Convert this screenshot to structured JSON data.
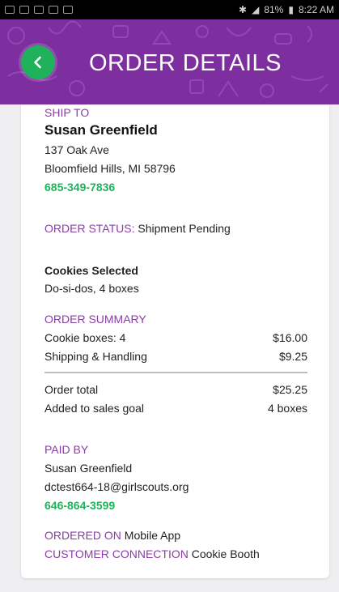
{
  "status_bar": {
    "battery": "81%",
    "time": "8:22 AM"
  },
  "header": {
    "title": "ORDER DETAILS",
    "back_icon": "chevron-left-icon",
    "accent_color": "#7e2f9f",
    "button_color": "#1fb25a"
  },
  "ship_to": {
    "label": "SHIP TO",
    "name": "Susan Greenfield",
    "address_line1": "137 Oak Ave",
    "address_line2": "Bloomfield Hills, MI 58796",
    "phone": "685-349-7836"
  },
  "order_status": {
    "label": "ORDER STATUS:",
    "value": "Shipment Pending"
  },
  "cookies": {
    "heading": "Cookies Selected",
    "value": "Do-si-dos, 4 boxes"
  },
  "summary": {
    "label": "ORDER SUMMARY",
    "lines": [
      {
        "label": "Cookie boxes: 4",
        "value": "$16.00"
      },
      {
        "label": "Shipping & Handling",
        "value": "$9.25"
      }
    ],
    "total_label": "Order total",
    "total_value": "$25.25",
    "goal_label": "Added to sales goal",
    "goal_value": "4 boxes"
  },
  "paid_by": {
    "label": "PAID BY",
    "name": "Susan Greenfield",
    "email": "dctest664-18@girlscouts.org",
    "phone": "646-864-3599"
  },
  "ordered_on": {
    "label": "ORDERED ON",
    "value": "Mobile App"
  },
  "customer_connection": {
    "label": "CUSTOMER CONNECTION",
    "value": "Cookie Booth"
  }
}
